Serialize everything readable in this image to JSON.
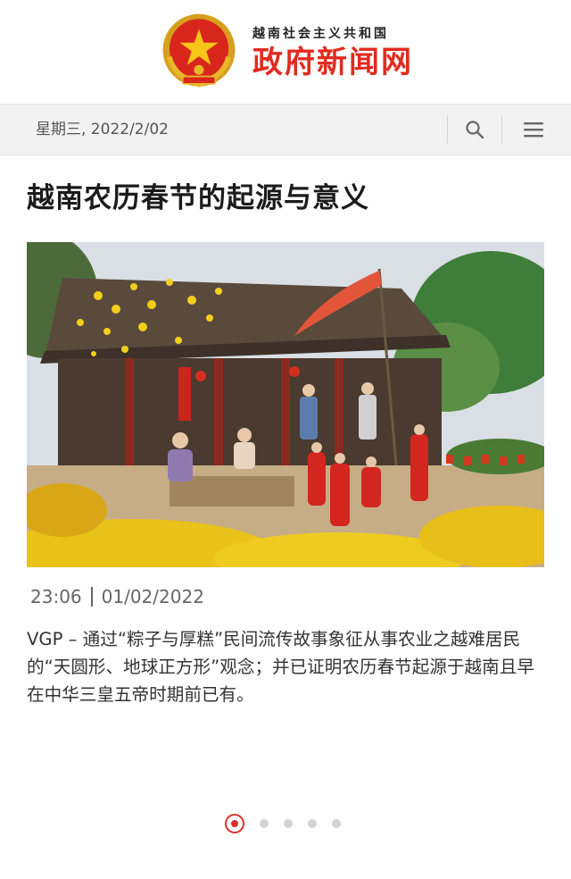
{
  "header": {
    "subtitle": "越南社会主义共和国",
    "site_name": "政府新闻网",
    "accent_color": "#e12b1f"
  },
  "toolbar": {
    "date": "星期三, 2022/2/02",
    "search_icon": "search-icon",
    "menu_icon": "hamburger-menu-icon"
  },
  "article": {
    "title": "越南农历春节的起源与意义",
    "image_alt": "photo-traditional-tet-house-with-apricot-blossoms-and-chrysanthemums",
    "time": "23:06",
    "date": "01/02/2022",
    "summary": "VGP – 通过“粽子与厚糕”民间流传故事象征从事农业之越难居民的“天圆形、地球正方形”观念；并已证明农历春节起源于越南且早在中华三皇五帝时期前已有。"
  },
  "pagination": {
    "total": 5,
    "active": 1,
    "active_color": "#d8312a"
  }
}
